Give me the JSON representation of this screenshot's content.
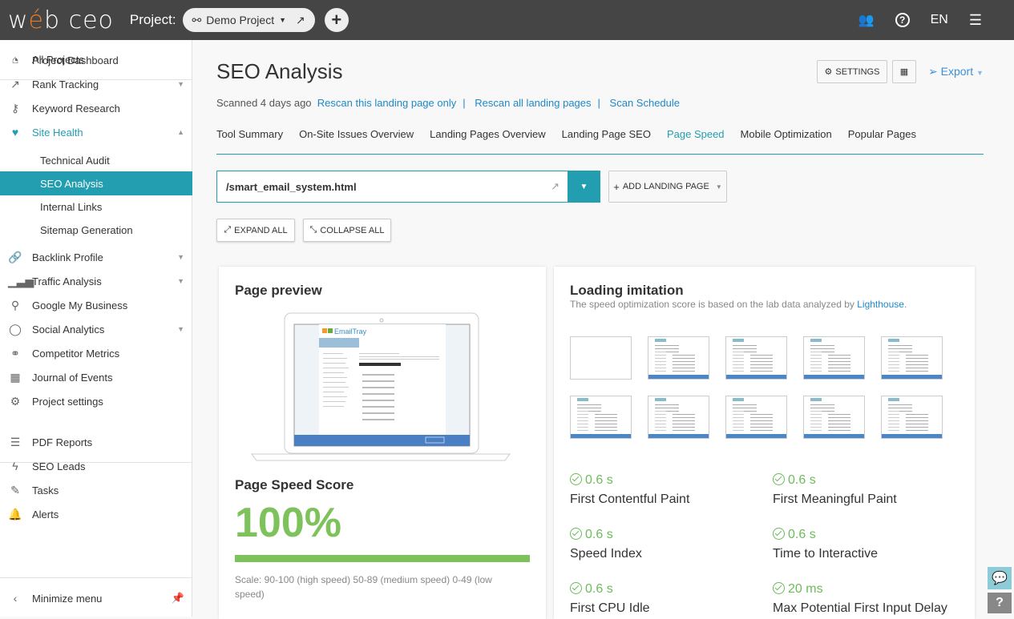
{
  "header": {
    "logo": "web ceo",
    "project_label": "Project:",
    "project_name": "Demo Project",
    "language": "EN"
  },
  "sidebar": {
    "all_projects": "All Projects",
    "items": [
      {
        "label": "Project Dashboard",
        "icon": "gauge-icon"
      },
      {
        "label": "Rank Tracking",
        "icon": "chart-line-icon",
        "expandable": true
      },
      {
        "label": "Keyword Research",
        "icon": "key-icon"
      },
      {
        "label": "Site Health",
        "icon": "heartbeat-icon",
        "expandable": true,
        "open": true
      },
      {
        "label": "Technical Audit"
      },
      {
        "label": "SEO Analysis",
        "active": true
      },
      {
        "label": "Internal Links"
      },
      {
        "label": "Sitemap Generation"
      },
      {
        "label": "Backlink Profile",
        "icon": "link-icon",
        "expandable": true
      },
      {
        "label": "Traffic Analysis",
        "icon": "bars-icon",
        "expandable": true
      },
      {
        "label": "Google My Business",
        "icon": "map-pin-icon"
      },
      {
        "label": "Social Analytics",
        "icon": "chat-icon",
        "expandable": true
      },
      {
        "label": "Competitor Metrics",
        "icon": "binoculars-icon"
      },
      {
        "label": "Journal of Events",
        "icon": "calendar-icon"
      },
      {
        "label": "Project settings",
        "icon": "gear-icon"
      },
      {
        "label": "PDF Reports",
        "icon": "report-icon"
      },
      {
        "label": "SEO Leads",
        "icon": "bolt-icon"
      },
      {
        "label": "Tasks",
        "icon": "tasks-icon"
      },
      {
        "label": "Alerts",
        "icon": "bell-icon"
      }
    ],
    "minimize": "Minimize menu"
  },
  "page": {
    "title": "SEO Analysis",
    "settings": "SETTINGS",
    "export": "Export",
    "scanned": "Scanned 4 days ago",
    "rescan_one": "Rescan this landing page only",
    "rescan_all": "Rescan all landing pages",
    "schedule": "Scan Schedule",
    "tabs": [
      "Tool Summary",
      "On-Site Issues Overview",
      "Landing Pages Overview",
      "Landing Page SEO",
      "Page Speed",
      "Mobile Optimization",
      "Popular Pages"
    ],
    "active_tab": "Page Speed",
    "url": "/smart_email_system.html",
    "add_landing": "ADD LANDING PAGE",
    "expand_all": "EXPAND ALL",
    "collapse_all": "COLLAPSE ALL"
  },
  "preview": {
    "title": "Page preview",
    "score_title": "Page Speed Score",
    "score": "100%",
    "score_value": 100,
    "score_color": "#7dc25b",
    "scale": "Scale: 90-100 (high speed) 50-89 (medium speed) 0-49 (low speed)"
  },
  "loading": {
    "title": "Loading imitation",
    "desc": "The speed optimization score is based on the lab data analyzed by ",
    "link": "Lighthouse",
    "desc_end": ".",
    "metrics": [
      {
        "value": "0.6 s",
        "label": "First Contentful Paint"
      },
      {
        "value": "0.6 s",
        "label": "First Meaningful Paint"
      },
      {
        "value": "0.6 s",
        "label": "Speed Index"
      },
      {
        "value": "0.6 s",
        "label": "Time to Interactive"
      },
      {
        "value": "0.6 s",
        "label": "First CPU Idle"
      },
      {
        "value": "20 ms",
        "label": "Max Potential First Input Delay"
      }
    ]
  },
  "colors": {
    "accent": "#239db0",
    "link": "#1e88c8",
    "good": "#6dbb5a"
  }
}
